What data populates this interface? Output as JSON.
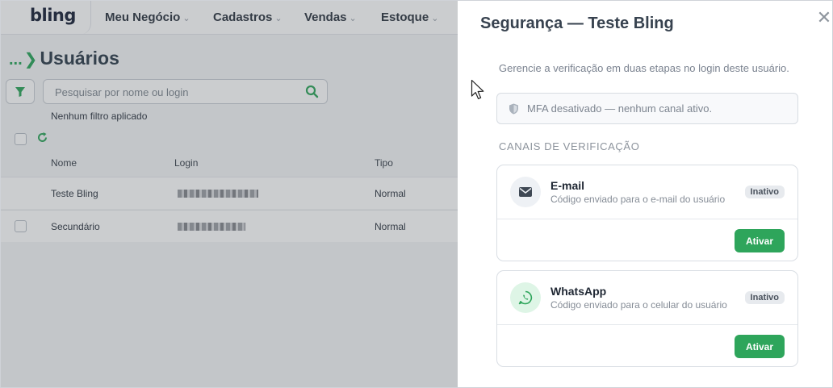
{
  "app": {
    "logo": "bling",
    "nav": [
      {
        "label": "Meu Negócio"
      },
      {
        "label": "Cadastros"
      },
      {
        "label": "Vendas"
      },
      {
        "label": "Estoque"
      }
    ],
    "breadcrumb_ellipsis": "...",
    "page_title": "Usuários",
    "search": {
      "placeholder": "Pesquisar por nome ou login",
      "value": ""
    },
    "filter_status": "Nenhum filtro aplicado",
    "table": {
      "columns": [
        "Nome",
        "Login",
        "Tipo"
      ],
      "rows": [
        {
          "nome": "Teste Bling",
          "tipo": "Normal"
        },
        {
          "nome": "Secundário",
          "tipo": "Normal"
        }
      ]
    }
  },
  "drawer": {
    "title": "Segurança — Teste Bling",
    "close_glyph": "✕",
    "description": "Gerencie a verificação em duas etapas no login deste usuário.",
    "mfa_status": "MFA desativado — nenhum canal ativo.",
    "section_title": "CANAIS DE VERIFICAÇÃO",
    "channels": [
      {
        "name": "E-mail",
        "description": "Código enviado para o e-mail do usuário",
        "status": "Inativo",
        "action": "Ativar",
        "icon": "envelope-icon"
      },
      {
        "name": "WhatsApp",
        "description": "Código enviado para o celular do usuário",
        "status": "Inativo",
        "action": "Ativar",
        "icon": "whatsapp-icon"
      }
    ]
  },
  "colors": {
    "accent_green": "#2ea55b",
    "title_text": "#37424f",
    "overlay": "rgba(70,74,82,0.28)"
  }
}
